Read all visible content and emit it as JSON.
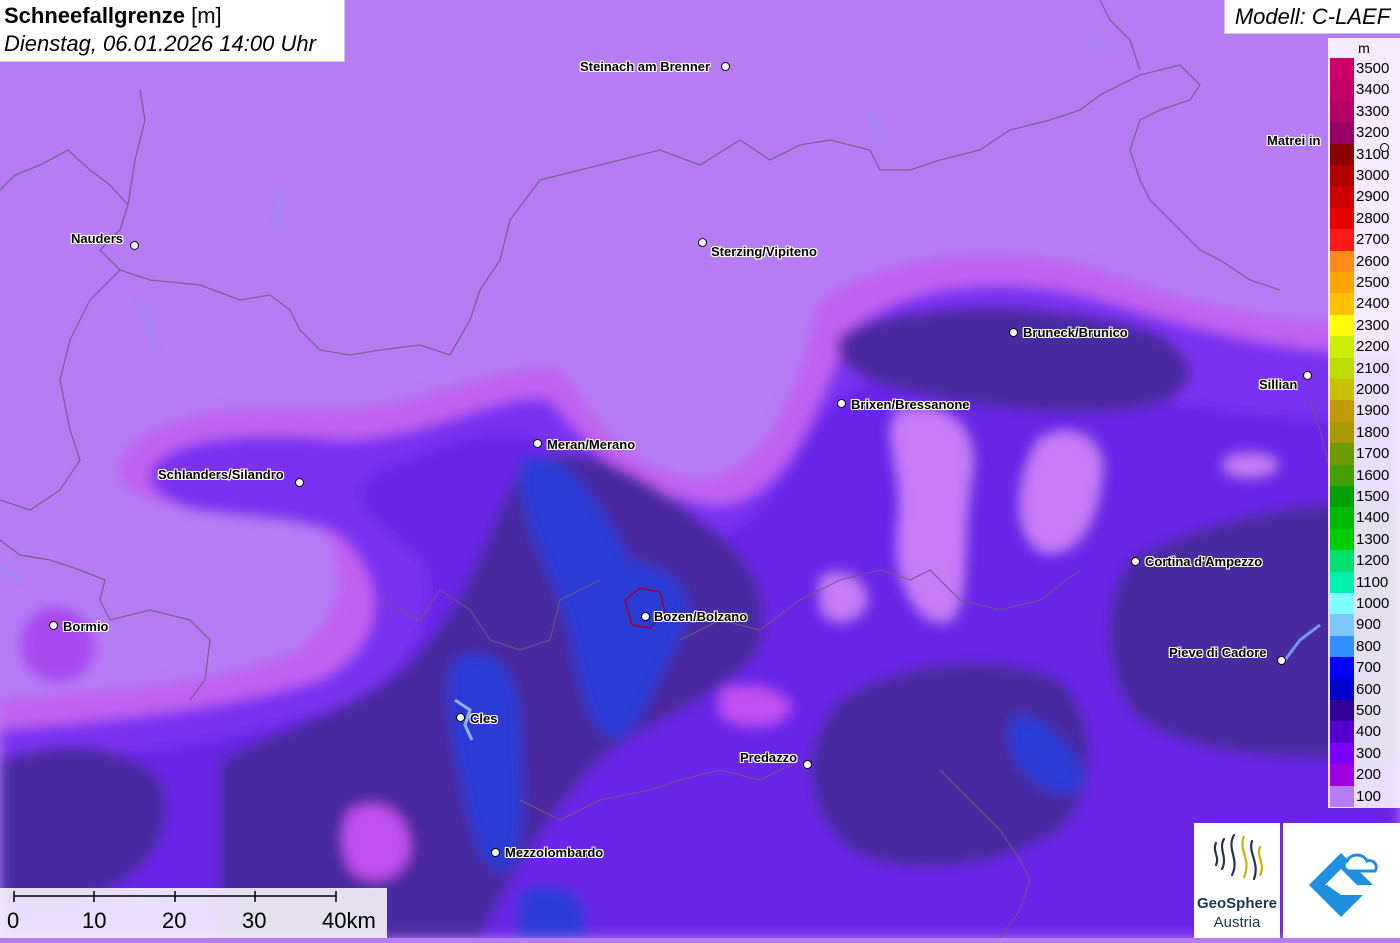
{
  "header": {
    "title": "Schneefallgrenze",
    "unit": "[m]",
    "datetime": "Dienstag, 06.01.2026 14:00 Uhr",
    "model": "Modell: C-LAEF"
  },
  "legend": {
    "unit": "m",
    "entries": [
      {
        "label": "3500",
        "color": "#cc0066"
      },
      {
        "label": "3400",
        "color": "#c20066"
      },
      {
        "label": "3300",
        "color": "#b30066"
      },
      {
        "label": "3200",
        "color": "#990066"
      },
      {
        "label": "3100",
        "color": "#8b0000"
      },
      {
        "label": "3000",
        "color": "#b20000"
      },
      {
        "label": "2900",
        "color": "#cc0000"
      },
      {
        "label": "2800",
        "color": "#e60000"
      },
      {
        "label": "2700",
        "color": "#ff1a1a"
      },
      {
        "label": "2600",
        "color": "#ff8c1a"
      },
      {
        "label": "2500",
        "color": "#ffa500"
      },
      {
        "label": "2400",
        "color": "#ffc000"
      },
      {
        "label": "2300",
        "color": "#ffff00"
      },
      {
        "label": "2200",
        "color": "#ccee00"
      },
      {
        "label": "2100",
        "color": "#bfdb00"
      },
      {
        "label": "2000",
        "color": "#c8c000"
      },
      {
        "label": "1900",
        "color": "#c09a00"
      },
      {
        "label": "1800",
        "color": "#a89a00"
      },
      {
        "label": "1700",
        "color": "#6f9a00"
      },
      {
        "label": "1600",
        "color": "#44a000"
      },
      {
        "label": "1500",
        "color": "#00a000"
      },
      {
        "label": "1400",
        "color": "#00bb00"
      },
      {
        "label": "1300",
        "color": "#00cc00"
      },
      {
        "label": "1200",
        "color": "#00e070"
      },
      {
        "label": "1100",
        "color": "#00f0b0"
      },
      {
        "label": "1000",
        "color": "#80ffff"
      },
      {
        "label": "900",
        "color": "#7fc8ff"
      },
      {
        "label": "800",
        "color": "#3090ff"
      },
      {
        "label": "700",
        "color": "#0000ff"
      },
      {
        "label": "600",
        "color": "#0000cc"
      },
      {
        "label": "500",
        "color": "#330099"
      },
      {
        "label": "400",
        "color": "#5500cc"
      },
      {
        "label": "300",
        "color": "#7a00ff"
      },
      {
        "label": "200",
        "color": "#a000e0"
      },
      {
        "label": "100",
        "color": "#b57cf4"
      }
    ]
  },
  "cities": [
    {
      "name": "Steinach am Brenner",
      "key": "steinach"
    },
    {
      "name": "Nauders",
      "key": "nauders"
    },
    {
      "name": "Sterzing/Vipiteno",
      "key": "sterzing"
    },
    {
      "name": "Matrei in",
      "key": "matrei"
    },
    {
      "name": "Bruneck/Brunico",
      "key": "bruneck"
    },
    {
      "name": "Sillian",
      "key": "sillian"
    },
    {
      "name": "Brixen/Bressanone",
      "key": "brixen"
    },
    {
      "name": "Meran/Merano",
      "key": "meran"
    },
    {
      "name": "Schlanders/Silandro",
      "key": "schlanders"
    },
    {
      "name": "Cortina d'Ampezzo",
      "key": "cortina"
    },
    {
      "name": "Bozen/Bolzano",
      "key": "bozen"
    },
    {
      "name": "Bormio",
      "key": "bormio"
    },
    {
      "name": "Pieve di Cadore",
      "key": "pieve"
    },
    {
      "name": "Cles",
      "key": "cles"
    },
    {
      "name": "Predazzo",
      "key": "predazzo"
    },
    {
      "name": "Mezzolombardo",
      "key": "mezzolombardo"
    }
  ],
  "scale": {
    "labels": [
      "0",
      "10",
      "20",
      "30",
      "40km"
    ]
  },
  "logos": {
    "geosphere_line1": "GeoSphere",
    "geosphere_line2": "Austria"
  }
}
